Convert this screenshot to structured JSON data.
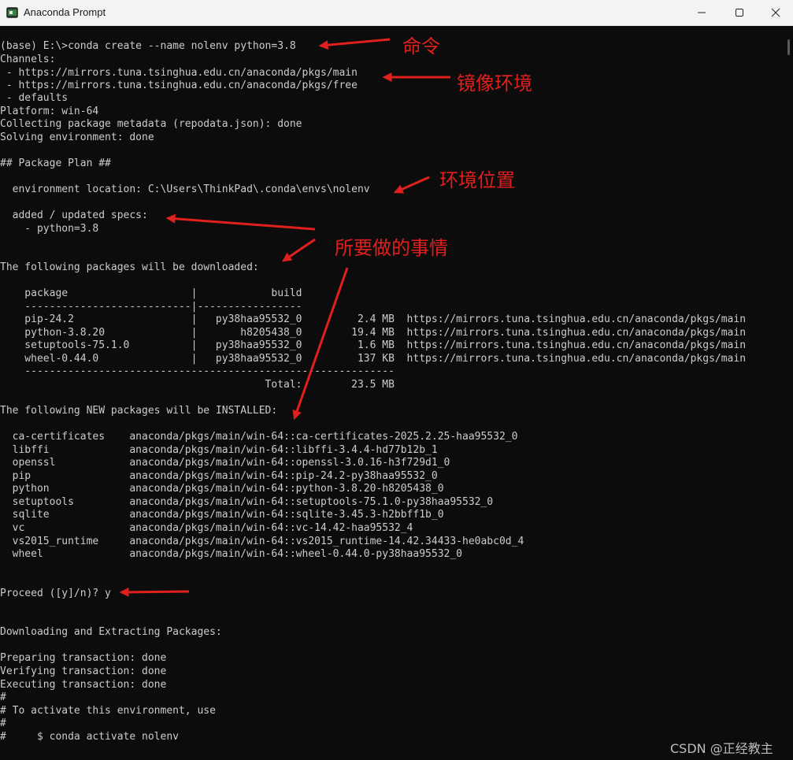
{
  "window": {
    "title": "Anaconda Prompt",
    "minimize": "─",
    "maximize": "☐",
    "close": "✕"
  },
  "terminal": {
    "l1": "(base) E:\\>conda create --name nolenv python=3.8",
    "l2": "Channels:",
    "l3": " - https://mirrors.tuna.tsinghua.edu.cn/anaconda/pkgs/main",
    "l4": " - https://mirrors.tuna.tsinghua.edu.cn/anaconda/pkgs/free",
    "l5": " - defaults",
    "l6": "Platform: win-64",
    "l7": "Collecting package metadata (repodata.json): done",
    "l8": "Solving environment: done",
    "l9": "## Package Plan ##",
    "l10": "  environment location: C:\\Users\\ThinkPad\\.conda\\envs\\nolenv",
    "l11": "  added / updated specs:",
    "l12": "    - python=3.8",
    "l13": "The following packages will be downloaded:",
    "l14": "    package                    |            build",
    "l15": "    ---------------------------|-----------------",
    "l16": "    pip-24.2                   |   py38haa95532_0         2.4 MB  https://mirrors.tuna.tsinghua.edu.cn/anaconda/pkgs/main",
    "l17": "    python-3.8.20              |       h8205438_0        19.4 MB  https://mirrors.tuna.tsinghua.edu.cn/anaconda/pkgs/main",
    "l18": "    setuptools-75.1.0          |   py38haa95532_0         1.6 MB  https://mirrors.tuna.tsinghua.edu.cn/anaconda/pkgs/main",
    "l19": "    wheel-0.44.0               |   py38haa95532_0         137 KB  https://mirrors.tuna.tsinghua.edu.cn/anaconda/pkgs/main",
    "l20": "    ------------------------------------------------------------",
    "l21": "                                           Total:        23.5 MB",
    "l22": "The following NEW packages will be INSTALLED:",
    "l23": "  ca-certificates    anaconda/pkgs/main/win-64::ca-certificates-2025.2.25-haa95532_0",
    "l24": "  libffi             anaconda/pkgs/main/win-64::libffi-3.4.4-hd77b12b_1",
    "l25": "  openssl            anaconda/pkgs/main/win-64::openssl-3.0.16-h3f729d1_0",
    "l26": "  pip                anaconda/pkgs/main/win-64::pip-24.2-py38haa95532_0",
    "l27": "  python             anaconda/pkgs/main/win-64::python-3.8.20-h8205438_0",
    "l28": "  setuptools         anaconda/pkgs/main/win-64::setuptools-75.1.0-py38haa95532_0",
    "l29": "  sqlite             anaconda/pkgs/main/win-64::sqlite-3.45.3-h2bbff1b_0",
    "l30": "  vc                 anaconda/pkgs/main/win-64::vc-14.42-haa95532_4",
    "l31": "  vs2015_runtime     anaconda/pkgs/main/win-64::vs2015_runtime-14.42.34433-he0abc0d_4",
    "l32": "  wheel              anaconda/pkgs/main/win-64::wheel-0.44.0-py38haa95532_0",
    "l33": "Proceed ([y]/n)? y",
    "l34": "Downloading and Extracting Packages:",
    "l35": "Preparing transaction: done",
    "l36": "Verifying transaction: done",
    "l37": "Executing transaction: done",
    "l38": "#",
    "l39": "# To activate this environment, use",
    "l40": "#",
    "l41": "#     $ conda activate nolenv"
  },
  "annotations": {
    "command": "命令",
    "mirror_env": "镜像环境",
    "env_location": "环境位置",
    "things_to_do": "所要做的事情"
  },
  "watermark": "CSDN @正经教主",
  "colors": {
    "annotation": "#e0201c",
    "terminal_bg": "#0c0c0c",
    "terminal_text": "#cccccc"
  }
}
